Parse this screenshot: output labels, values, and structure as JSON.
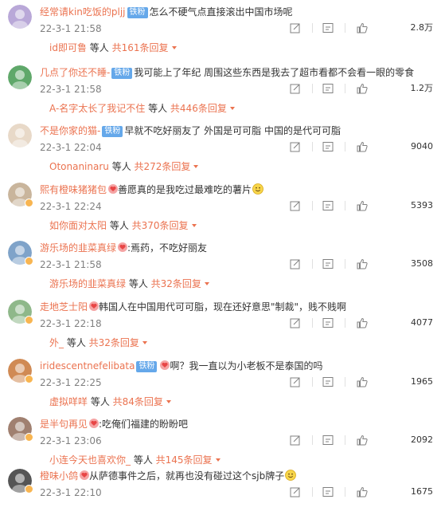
{
  "colors": {
    "accent": "#eb7350",
    "badge": "#65a8ea",
    "verified": "#f8b551",
    "muted": "#808080"
  },
  "icons": {
    "forward": "share-icon",
    "comment": "comment-icon",
    "like": "thumb-up-icon"
  },
  "comments": [
    {
      "user": "经常请kin吃饭的pljj",
      "badge": "铁粉",
      "text": "怎么不硬气点直接滚出中国市场呢",
      "time": "22-3-1 21:58",
      "likes": "2.8万",
      "reply_user": "id即可鲁",
      "reply_mid": " 等人 ",
      "reply_count": "共161条回复",
      "emoji": ""
    },
    {
      "user": "几点了你还不睡-",
      "badge": "铁粉",
      "text": "我可能上了年纪 周围这些东西是我去了超市看都不会看一眼的零食",
      "time": "22-3-1 21:58",
      "likes": "1.2万",
      "reply_user": "A-名字太长了我记不住",
      "reply_mid": " 等人 ",
      "reply_count": "共446条回复",
      "emoji": ""
    },
    {
      "user": "不是你家的猫-",
      "badge": "铁粉",
      "text": "早就不吃好丽友了 外国是可可脂 中国的是代可可脂",
      "time": "22-3-1 22:04",
      "likes": "9040",
      "reply_user": "Otonaninaru",
      "reply_mid": " 等人 ",
      "reply_count": "共272条回复",
      "emoji": ""
    },
    {
      "user": "熙有橙味猪猪包",
      "badge": "",
      "text": "善愿真的是我吃过最难吃的薯片",
      "time": "22-3-1 22:24",
      "likes": "5393",
      "reply_user": "如你面对太阳",
      "reply_mid": " 等人 ",
      "reply_count": "共370条回复",
      "emoji": "smile"
    },
    {
      "user": "游乐场的韭菜真绿",
      "badge": "",
      "text": ":焉药，不吃好丽友",
      "time": "22-3-1 21:58",
      "likes": "3508",
      "reply_user": "游乐场的韭菜真绿",
      "reply_mid": " 等人 ",
      "reply_count": "共32条回复",
      "emoji": ""
    },
    {
      "user": "走地芝士阳",
      "badge": "",
      "text": "韩国人在中国用代可可脂，现在还好意思\"制裁\"，贱不贱啊",
      "time": "22-3-1 22:18",
      "likes": "4077",
      "reply_user": "外_",
      "reply_mid": " 等人 ",
      "reply_count": "共32条回复",
      "emoji": ""
    },
    {
      "user": "iridescentnefelibata",
      "badge": "铁粉",
      "text": "啊？我一直以为小老板不是泰国的吗",
      "time": "22-3-1 22:25",
      "likes": "1965",
      "reply_user": "虚拟咩咩",
      "reply_mid": " 等人 ",
      "reply_count": "共84条回复",
      "emoji": ""
    },
    {
      "user": "是半句再见",
      "badge": "",
      "text": ":吃俺们福建的盼盼吧",
      "time": "22-3-1 23:06",
      "likes": "2092",
      "reply_user": "小连今天也喜欢你_",
      "reply_mid": " 等人 ",
      "reply_count": "共145条回复",
      "emoji": ""
    },
    {
      "user": "橙味小鸽",
      "badge": "",
      "text": "从萨德事件之后，就再也没有碰过这个sjb牌子",
      "time": "22-3-1 22:10",
      "likes": "1675",
      "reply_user": "",
      "reply_mid": "",
      "reply_count": "",
      "emoji": "smile"
    }
  ]
}
